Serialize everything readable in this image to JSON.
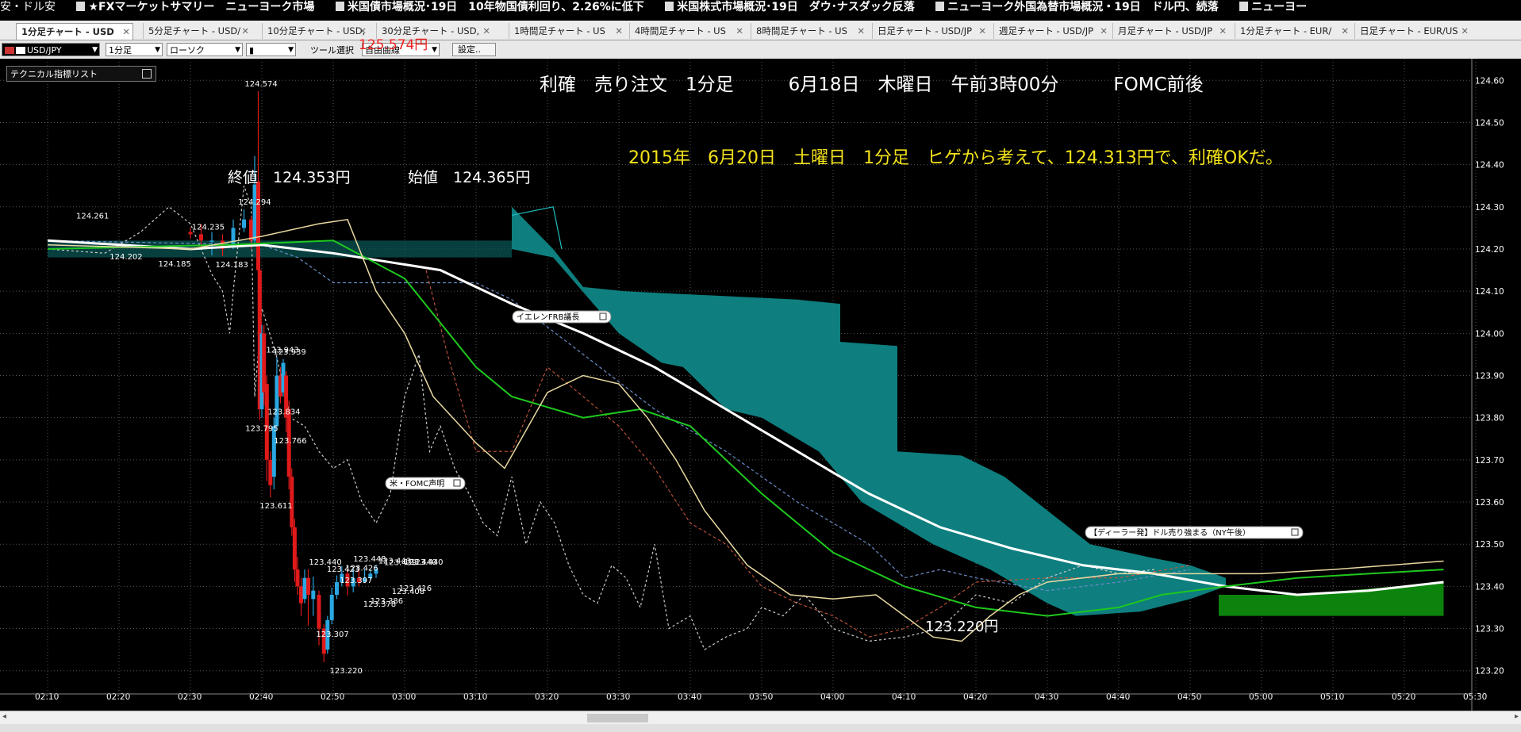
{
  "ticker": {
    "items": [
      "安・ドル安",
      "★FXマーケットサマリー　ニューヨーク市場",
      "米国債市場概況･19日　10年物国債利回り、2.26%に低下",
      "米国株式市場概況･19日　ダウ･ナスダック反落",
      "ニューヨーク外国為替市場概況・19日　ドル円、続落",
      "ニューヨー"
    ]
  },
  "tabs": [
    {
      "label": "1分足チャート - USD",
      "active": true
    },
    {
      "label": "5分足チャート - USD/"
    },
    {
      "label": "10分足チャート - USD,"
    },
    {
      "label": "30分足チャート - USD,"
    },
    {
      "label": "1時間足チャート - US"
    },
    {
      "label": "4時間足チャート - US"
    },
    {
      "label": "8時間足チャート - US"
    },
    {
      "label": "日足チャート - USD/JP"
    },
    {
      "label": "週足チャート - USD/JP"
    },
    {
      "label": "月足チャート - USD/JP"
    },
    {
      "label": "1分足チャート - EUR/"
    },
    {
      "label": "日足チャート - EUR/US"
    }
  ],
  "toolbar": {
    "pair": "USD/JPY",
    "timeframe": "1分足",
    "chart_style": "ローソク",
    "tool_label": "ツール選択",
    "draw_select": "自由曲線",
    "settings": "設定..",
    "red_value": "125.574円"
  },
  "indicator_list": "テクニカル指標リスト",
  "annotations": {
    "headline": "利確　売り注文　1分足　　　6月18日　木曜日　午前3時00分　　　FOMC前後",
    "note": "2015年　6月20日　土曜日　1分足　ヒゲから考えて、124.313円で、利確OKだ。",
    "close": "終値　124.353円",
    "open": "始値　124.365円",
    "low_label": "123.220円",
    "news_fomc": "米・FOMC声明",
    "news_yellen": "イエレンFRB議長",
    "news_dealer": "【ディーラー発】ドル売り強まる（NY午後）"
  },
  "colors": {
    "up": "#2aa7e0",
    "down": "#e01a1a",
    "kumo": "#0f8585",
    "kumo_green": "#0d8a0d",
    "ma_white": "#ffffff",
    "ma_green": "#1ec81e",
    "ma_yellow": "#e8d9a0",
    "headline": "#ffffff",
    "note": "#f2e21a"
  },
  "chart_data": {
    "type": "candlestick",
    "xlabels": [
      "02:10",
      "02:20",
      "02:30",
      "02:40",
      "02:50",
      "03:00",
      "03:10",
      "03:20",
      "03:30",
      "03:40",
      "03:50",
      "04:00",
      "04:10",
      "04:20",
      "04:30",
      "04:40",
      "04:50",
      "05:00",
      "05:10",
      "05:20",
      "05:30"
    ],
    "ylabels": [
      "124.60",
      "124.50",
      "124.40",
      "124.30",
      "124.20",
      "124.10",
      "124.00",
      "123.90",
      "123.80",
      "123.70",
      "123.60",
      "123.50",
      "123.40",
      "123.30",
      "123.20"
    ],
    "ylim": [
      123.175,
      124.625
    ],
    "point_labels": [
      {
        "text": "124.574",
        "t": 2.96,
        "v": 124.574,
        "pos": "above"
      },
      {
        "text": "124.261",
        "t": 0.6,
        "v": 124.261,
        "pos": "above"
      },
      {
        "text": "124.235",
        "t": 2.22,
        "v": 124.235,
        "pos": "above"
      },
      {
        "text": "124.294",
        "t": 2.87,
        "v": 124.294,
        "pos": "above"
      },
      {
        "text": "124.202",
        "t": 1.07,
        "v": 124.202,
        "pos": "below"
      },
      {
        "text": "124.185",
        "t": 1.75,
        "v": 124.185,
        "pos": "below"
      },
      {
        "text": "124.183",
        "t": 2.55,
        "v": 124.183,
        "pos": "below"
      },
      {
        "text": "123.795",
        "t": 2.97,
        "v": 123.795,
        "pos": "below"
      },
      {
        "text": "123.611",
        "t": 3.17,
        "v": 123.611,
        "pos": "below"
      },
      {
        "text": "123.943",
        "t": 3.26,
        "v": 123.943,
        "pos": "above"
      },
      {
        "text": "123.939",
        "t": 3.36,
        "v": 123.939,
        "pos": "above"
      },
      {
        "text": "123.834",
        "t": 3.28,
        "v": 123.834,
        "pos": "below"
      },
      {
        "text": "123.766",
        "t": 3.37,
        "v": 123.766,
        "pos": "below"
      },
      {
        "text": "123.440",
        "t": 3.86,
        "v": 123.44,
        "pos": "above"
      },
      {
        "text": "123.307",
        "t": 3.96,
        "v": 123.307,
        "pos": "below"
      },
      {
        "text": "123.423",
        "t": 4.11,
        "v": 123.423,
        "pos": "above"
      },
      {
        "text": "123.220",
        "t": 4.15,
        "v": 123.22,
        "pos": "below"
      },
      {
        "text": "123.397",
        "t": 4.29,
        "v": 123.397,
        "pos": "above"
      },
      {
        "text": "123.426",
        "t": 4.37,
        "v": 123.426,
        "pos": "above"
      },
      {
        "text": "123.448",
        "t": 4.48,
        "v": 123.448,
        "pos": "above"
      },
      {
        "text": "123.378",
        "t": 4.62,
        "v": 123.378,
        "pos": "below"
      },
      {
        "text": "123.386",
        "t": 4.72,
        "v": 123.386,
        "pos": "below"
      },
      {
        "text": "123.443",
        "t": 4.83,
        "v": 123.443,
        "pos": "above"
      },
      {
        "text": "123.439",
        "t": 4.91,
        "v": 123.439,
        "pos": "above"
      },
      {
        "text": "123.408",
        "t": 5.02,
        "v": 123.408,
        "pos": "below"
      },
      {
        "text": "123.416",
        "t": 5.12,
        "v": 123.416,
        "pos": "below"
      },
      {
        "text": "123.440",
        "t": 5.19,
        "v": 123.44,
        "pos": "above"
      },
      {
        "text": "123.440",
        "t": 5.28,
        "v": 123.44,
        "pos": "above"
      }
    ],
    "candles": [
      {
        "t": 2.0,
        "o": 124.24,
        "c": 124.235,
        "h": 124.25,
        "l": 124.225
      },
      {
        "t": 2.15,
        "o": 124.235,
        "c": 124.22,
        "h": 124.26,
        "l": 124.2
      },
      {
        "t": 2.3,
        "o": 124.22,
        "c": 124.22,
        "h": 124.24,
        "l": 124.185
      },
      {
        "t": 2.45,
        "o": 124.22,
        "c": 124.2,
        "h": 124.235,
        "l": 124.183
      },
      {
        "t": 2.6,
        "o": 124.21,
        "c": 124.25,
        "h": 124.27,
        "l": 124.2
      },
      {
        "t": 2.75,
        "o": 124.25,
        "c": 124.27,
        "h": 124.294,
        "l": 124.24
      },
      {
        "t": 2.85,
        "o": 124.27,
        "c": 124.22,
        "h": 124.28,
        "l": 124.2
      },
      {
        "t": 2.9,
        "o": 124.22,
        "c": 124.353,
        "h": 124.42,
        "l": 124.21
      },
      {
        "t": 2.95,
        "o": 124.36,
        "c": 124.15,
        "h": 124.574,
        "l": 124.05
      },
      {
        "t": 2.97,
        "o": 124.15,
        "c": 123.82,
        "h": 124.2,
        "l": 123.795
      },
      {
        "t": 3.0,
        "o": 123.82,
        "c": 124.0,
        "h": 124.02,
        "l": 123.8
      },
      {
        "t": 3.03,
        "o": 124.0,
        "c": 123.86,
        "h": 124.02,
        "l": 123.83
      },
      {
        "t": 3.07,
        "o": 123.88,
        "c": 123.7,
        "h": 123.9,
        "l": 123.65
      },
      {
        "t": 3.12,
        "o": 123.7,
        "c": 123.64,
        "h": 123.72,
        "l": 123.611
      },
      {
        "t": 3.17,
        "o": 123.66,
        "c": 123.78,
        "h": 123.8,
        "l": 123.63
      },
      {
        "t": 3.21,
        "o": 123.78,
        "c": 123.9,
        "h": 123.943,
        "l": 123.77
      },
      {
        "t": 3.26,
        "o": 123.9,
        "c": 123.85,
        "h": 123.92,
        "l": 123.834
      },
      {
        "t": 3.3,
        "o": 123.86,
        "c": 123.93,
        "h": 123.939,
        "l": 123.85
      },
      {
        "t": 3.34,
        "o": 123.9,
        "c": 123.8,
        "h": 123.91,
        "l": 123.766
      },
      {
        "t": 3.38,
        "o": 123.82,
        "c": 123.66,
        "h": 123.84,
        "l": 123.63
      },
      {
        "t": 3.42,
        "o": 123.66,
        "c": 123.54,
        "h": 123.68,
        "l": 123.52
      },
      {
        "t": 3.46,
        "o": 123.54,
        "c": 123.44,
        "h": 123.56,
        "l": 123.41
      },
      {
        "t": 3.5,
        "o": 123.44,
        "c": 123.4,
        "h": 123.47,
        "l": 123.38
      },
      {
        "t": 3.55,
        "o": 123.4,
        "c": 123.36,
        "h": 123.42,
        "l": 123.33
      },
      {
        "t": 3.6,
        "o": 123.37,
        "c": 123.42,
        "h": 123.44,
        "l": 123.36
      },
      {
        "t": 3.65,
        "o": 123.42,
        "c": 123.38,
        "h": 123.44,
        "l": 123.307
      },
      {
        "t": 3.72,
        "o": 123.37,
        "c": 123.39,
        "h": 123.423,
        "l": 123.33
      },
      {
        "t": 3.8,
        "o": 123.38,
        "c": 123.3,
        "h": 123.39,
        "l": 123.26
      },
      {
        "t": 3.87,
        "o": 123.3,
        "c": 123.24,
        "h": 123.31,
        "l": 123.22
      },
      {
        "t": 3.92,
        "o": 123.25,
        "c": 123.32,
        "h": 123.33,
        "l": 123.24
      },
      {
        "t": 3.98,
        "o": 123.32,
        "c": 123.38,
        "h": 123.397,
        "l": 123.31
      },
      {
        "t": 4.05,
        "o": 123.38,
        "c": 123.41,
        "h": 123.426,
        "l": 123.37
      },
      {
        "t": 4.12,
        "o": 123.41,
        "c": 123.43,
        "h": 123.448,
        "l": 123.4
      },
      {
        "t": 4.2,
        "o": 123.43,
        "c": 123.4,
        "h": 123.44,
        "l": 123.378
      },
      {
        "t": 4.28,
        "o": 123.4,
        "c": 123.42,
        "h": 123.443,
        "l": 123.386
      },
      {
        "t": 4.36,
        "o": 123.42,
        "c": 123.41,
        "h": 123.439,
        "l": 123.4
      },
      {
        "t": 4.44,
        "o": 123.41,
        "c": 123.42,
        "h": 123.44,
        "l": 123.408
      },
      {
        "t": 4.52,
        "o": 123.42,
        "c": 123.43,
        "h": 123.44,
        "l": 123.416
      },
      {
        "t": 4.6,
        "o": 123.43,
        "c": 123.44,
        "h": 123.45,
        "l": 123.42
      }
    ]
  }
}
